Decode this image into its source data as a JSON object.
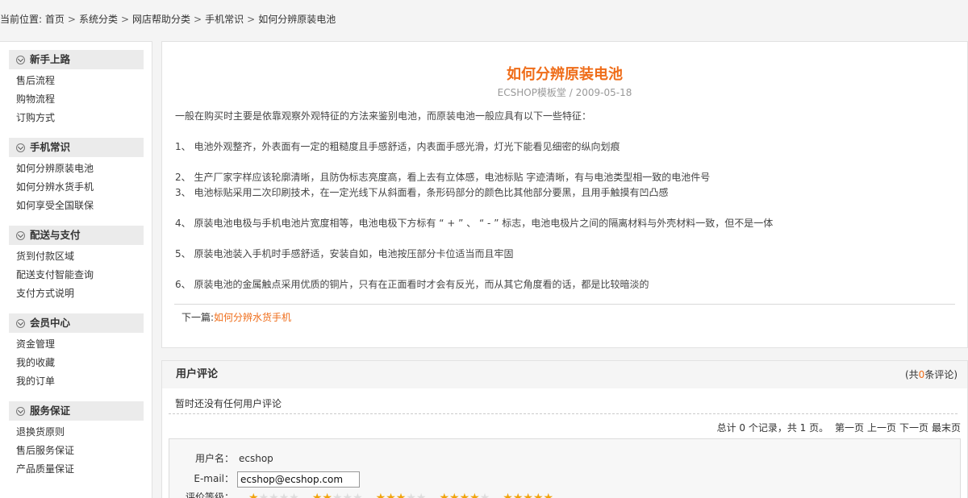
{
  "breadcrumb": {
    "prefix": "当前位置:",
    "items": [
      "首页",
      "系统分类",
      "网店帮助分类",
      "手机常识",
      "如何分辨原装电池"
    ],
    "separator": ">"
  },
  "sidebar": {
    "categories": [
      {
        "title": "新手上路",
        "items": [
          "售后流程",
          "购物流程",
          "订购方式"
        ]
      },
      {
        "title": "手机常识",
        "items": [
          "如何分辨原装电池",
          "如何分辨水货手机",
          "如何享受全国联保"
        ]
      },
      {
        "title": "配送与支付",
        "items": [
          "货到付款区域",
          "配送支付智能查询",
          "支付方式说明"
        ]
      },
      {
        "title": "会员中心",
        "items": [
          "资金管理",
          "我的收藏",
          "我的订单"
        ]
      },
      {
        "title": "服务保证",
        "items": [
          "退换货原则",
          "售后服务保证",
          "产品质量保证"
        ]
      }
    ]
  },
  "article": {
    "title": "如何分辨原装电池",
    "meta": "ECSHOP模板堂 / 2009-05-18",
    "paragraphs": [
      "一般在购买时主要是依靠观察外观特征的方法来鉴别电池，而原装电池一般应具有以下一些特征：",
      "1、 电池外观整齐，外表面有一定的粗糙度且手感舒适，内表面手感光滑，灯光下能看见细密的纵向划痕",
      "2、 生产厂家字样应该轮廓清晰，且防伪标志亮度高，看上去有立体感，电池标贴 字迹清晰，有与电池类型相一致的电池件号",
      "3、 电池标贴采用二次印刷技术，在一定光线下从斜面看，条形码部分的颜色比其他部分要黑，且用手触摸有凹凸感",
      "4、 原装电池电极与手机电池片宽度相等，电池电极下方标有 “ + ” 、 “ - ” 标志，电池电极片之间的隔离材料与外壳材料一致，但不是一体",
      "5、 原装电池装入手机时手感舒适，安装自如，电池按压部分卡位适当而且牢固",
      "6、 原装电池的金属触点采用优质的铜片，只有在正面看时才会有反光，而从其它角度看的话，都是比较暗淡的"
    ],
    "next_label": "下一篇:",
    "next_link": "如何分辨水货手机"
  },
  "comments": {
    "title": "用户评论",
    "count_prefix": "(共",
    "count": "0",
    "count_suffix": "条评论)",
    "empty": "暂时还没有任何用户评论",
    "pager_summary": "总计 0 个记录，共 1 页。",
    "pager_links": [
      "第一页",
      "上一页",
      "下一页",
      "最末页"
    ],
    "form": {
      "username_label": "用户名：",
      "username_value": "ecshop",
      "email_label": "E-mail：",
      "email_value": "ecshop@ecshop.com",
      "rating_label": "评价等级：",
      "rating_options": [
        1,
        2,
        3,
        4,
        5
      ],
      "star_color": "#f0a30a"
    }
  },
  "colors": {
    "accent": "#ef6d1a",
    "background": "#f4f4f4"
  }
}
